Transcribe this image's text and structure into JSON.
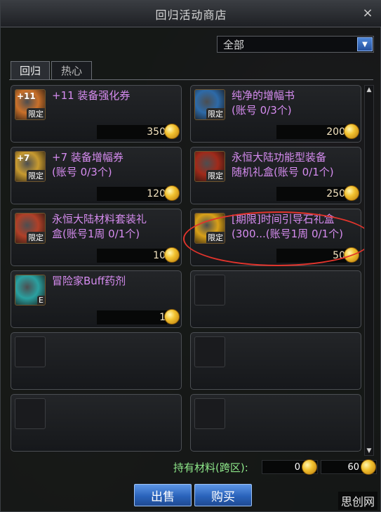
{
  "window": {
    "title": "回归活动商店",
    "close_icon": "×"
  },
  "filter": {
    "selected": "全部"
  },
  "tabs": [
    {
      "label": "回归"
    },
    {
      "label": "热心"
    }
  ],
  "items": [
    {
      "name": "+11 装备强化券",
      "price": "350",
      "badge": "限定",
      "icon_text": "+11",
      "icon_color": "#c9702a"
    },
    {
      "name": "纯净的增幅书\n(账号 0/3个)",
      "price": "200",
      "badge": "限定",
      "icon_text": "",
      "icon_color": "#2d6aa8"
    },
    {
      "name": "+7 装备增幅券\n(账号 0/3个)",
      "price": "120",
      "badge": "限定",
      "icon_text": "+7",
      "icon_color": "#c79a30"
    },
    {
      "name": "永恒大陆功能型装备\n随机礼盒(账号 0/1个)",
      "price": "250",
      "badge": "限定",
      "icon_text": "",
      "icon_color": "#a02a1a"
    },
    {
      "name": "永恒大陆材料套装礼\n盒(账号1周 0/1个)",
      "price": "10",
      "badge": "限定",
      "icon_text": "",
      "icon_color": "#b04028"
    },
    {
      "name": "[期限]时间引导石礼盒\n(300...(账号1周 0/1个)",
      "price": "50",
      "badge": "限定",
      "icon_text": "",
      "icon_color": "#d8a018"
    },
    {
      "name": "冒险家Buff药剂",
      "price": "1",
      "badge": "E",
      "icon_text": "",
      "icon_color": "#2aa0a0"
    }
  ],
  "footer": {
    "label": "持有材料(跨区):",
    "amount_a": "0",
    "amount_b": "60",
    "sell_label": "出售",
    "buy_label": "购买"
  },
  "watermark": "思创网",
  "colors": {
    "item_name": "#d68cf0",
    "footer_label": "#8ee88a",
    "annotation": "#e2342c",
    "button": "#2a63bb"
  }
}
